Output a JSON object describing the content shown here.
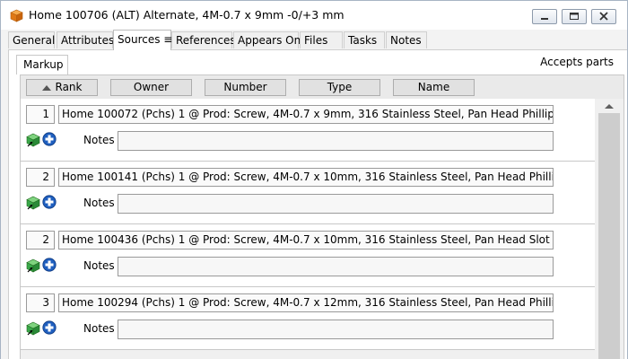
{
  "window": {
    "title": "Home 100706 (ALT) Alternate, 4M-0.7 x 9mm -0/+3 mm",
    "app_icon": "orange-cube-icon"
  },
  "tabs": [
    {
      "label": "General"
    },
    {
      "label": "Attributes"
    },
    {
      "label": "Sources ≡",
      "active": true
    },
    {
      "label": "References"
    },
    {
      "label": "Appears On"
    },
    {
      "label": "Files"
    },
    {
      "label": "Tasks"
    },
    {
      "label": "Notes"
    }
  ],
  "subtab": {
    "label": "Markup"
  },
  "accepts_parts": "Accepts parts",
  "columns": [
    {
      "label": "Rank",
      "sorted": "ascending"
    },
    {
      "label": "Owner"
    },
    {
      "label": "Number"
    },
    {
      "label": "Type"
    },
    {
      "label": "Name"
    }
  ],
  "notes_label": "Notes",
  "sources": [
    {
      "rank": "1",
      "description": "Home  100072  (Pchs)  1 @ Prod:  Screw, 4M-0.7 x 9mm, 316 Stainless Steel, Pan Head Phillips",
      "notes": ""
    },
    {
      "rank": "2",
      "description": "Home  100141  (Pchs)  1 @ Prod:  Screw, 4M-0.7 x 10mm, 316 Stainless Steel, Pan Head Phillips",
      "notes": ""
    },
    {
      "rank": "2",
      "description": "Home  100436  (Pchs)  1 @ Prod:  Screw, 4M-0.7 x 10mm, 316 Stainless Steel, Pan Head Slot",
      "notes": ""
    },
    {
      "rank": "3",
      "description": "Home  100294  (Pchs)  1 @ Prod:  Screw, 4M-0.7 x 12mm, 316 Stainless Steel, Pan Head Phillips",
      "notes": ""
    }
  ],
  "icons": {
    "row_action_1": "green-cube-icon",
    "row_action_2": "blue-plus-circle-icon"
  },
  "colors": {
    "accent_blue": "#1f5fbf",
    "cube_green": "#3aa84a",
    "cube_orange": "#f08a24"
  }
}
